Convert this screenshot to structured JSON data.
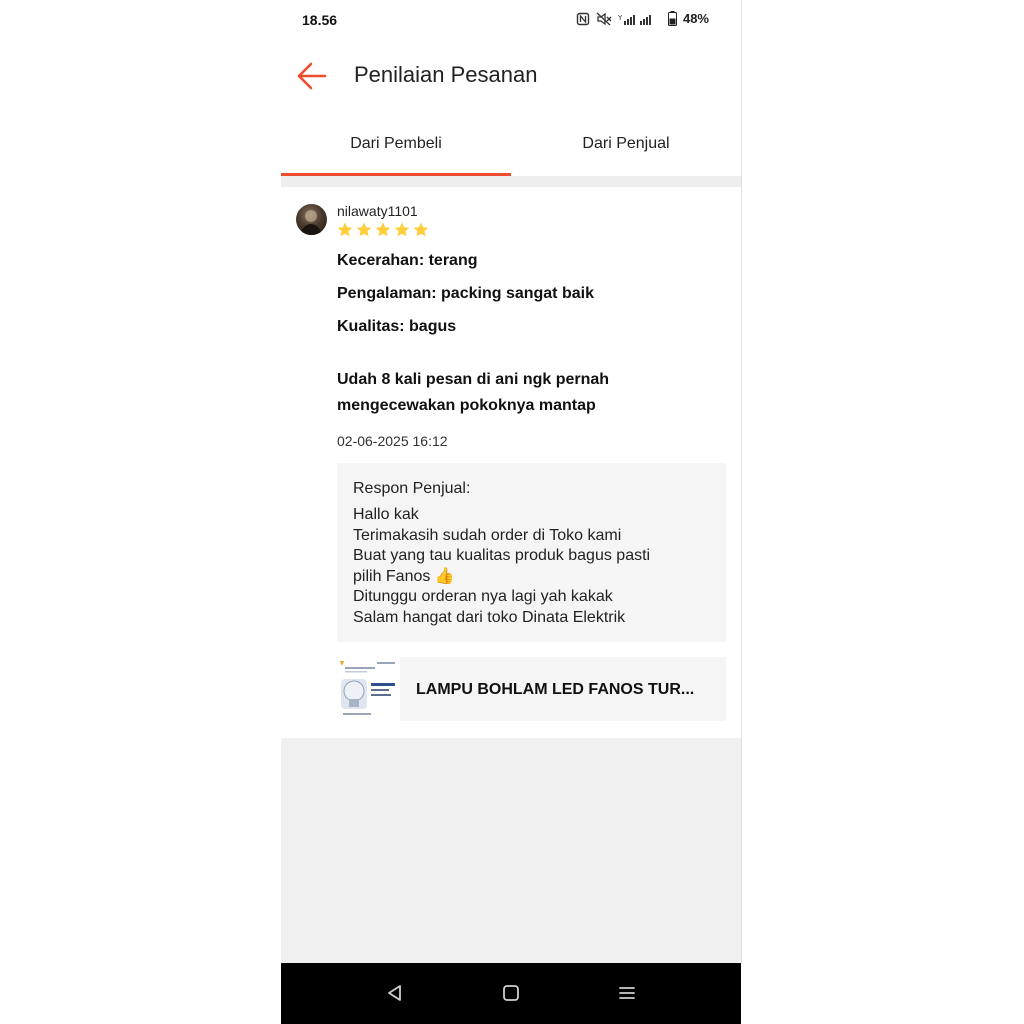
{
  "status_bar": {
    "time": "18.56",
    "battery": "48%"
  },
  "header": {
    "title": "Penilaian Pesanan",
    "accent_color": "#ee4d2d"
  },
  "tabs": [
    {
      "label": "Dari Pembeli",
      "active": true
    },
    {
      "label": "Dari Penjual",
      "active": false
    }
  ],
  "review": {
    "username": "nilawaty1101",
    "rating": 5,
    "star_color": "#ffce3d",
    "attributes": [
      "Kecerahan: terang",
      "Pengalaman: packing sangat baik",
      "Kualitas: bagus"
    ],
    "text_line1": "Udah 8 kali pesan di ani ngk pernah",
    "text_line2": "mengecewakan pokoknya mantap",
    "date": "02-06-2025 16:12",
    "seller_response": {
      "title": "Respon Penjual:",
      "lines": [
        "Hallo kak",
        "Terimakasih sudah order di Toko kami",
        "Buat yang tau kualitas produk bagus pasti",
        "pilih Fanos 👍",
        "Ditunggu orderan nya lagi yah kakak",
        "Salam hangat dari toko Dinata Elektrik"
      ]
    },
    "product": {
      "name": "LAMPU BOHLAM LED FANOS TUR..."
    }
  },
  "nav_bar": {
    "buttons": [
      "back",
      "home",
      "menu"
    ]
  }
}
